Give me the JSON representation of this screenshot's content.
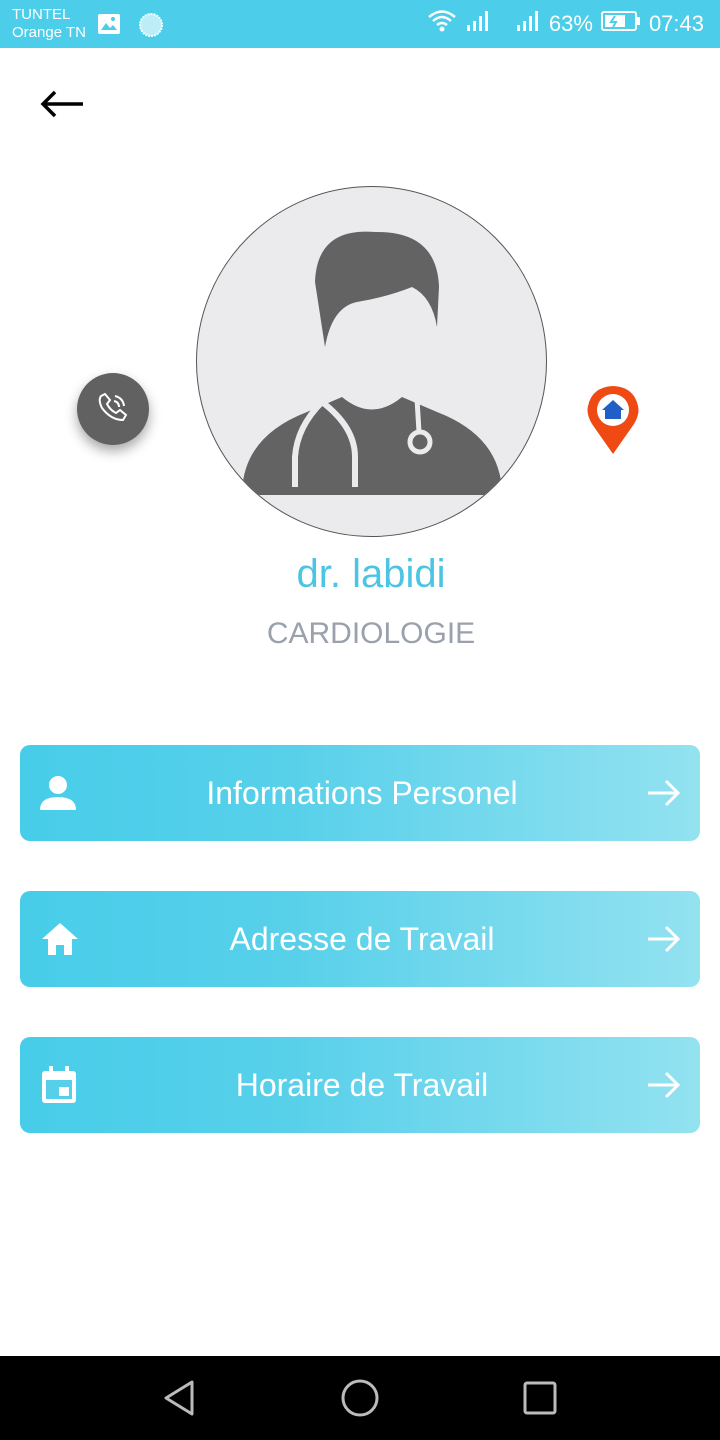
{
  "status_bar": {
    "carrier_line1": "TUNTEL",
    "carrier_line2": "Orange TN",
    "battery_percent": "63%",
    "time": "07:43",
    "icons": [
      "image-icon",
      "circle-icon",
      "wifi-icon",
      "signal-icon",
      "signal-icon",
      "battery-icon"
    ],
    "background_color": "#4ccde9"
  },
  "header": {
    "back_icon": "arrow-left-icon"
  },
  "profile": {
    "name": "dr. labidi",
    "specialty": "CARDIOLOGIE",
    "name_color": "#4cc5e4",
    "call_icon": "phone-icon",
    "location_icon": "home-map-pin-icon"
  },
  "menu": {
    "items": [
      {
        "label": "Informations Personel",
        "icon": "person-icon",
        "arrow": "arrow-right-icon"
      },
      {
        "label": "Adresse de Travail",
        "icon": "home-icon",
        "arrow": "arrow-right-icon"
      },
      {
        "label": "Horaire de Travail",
        "icon": "calendar-icon",
        "arrow": "arrow-right-icon"
      }
    ]
  },
  "nav_bar": {
    "buttons": [
      "back-triangle-icon",
      "home-circle-icon",
      "recents-square-icon"
    ]
  }
}
